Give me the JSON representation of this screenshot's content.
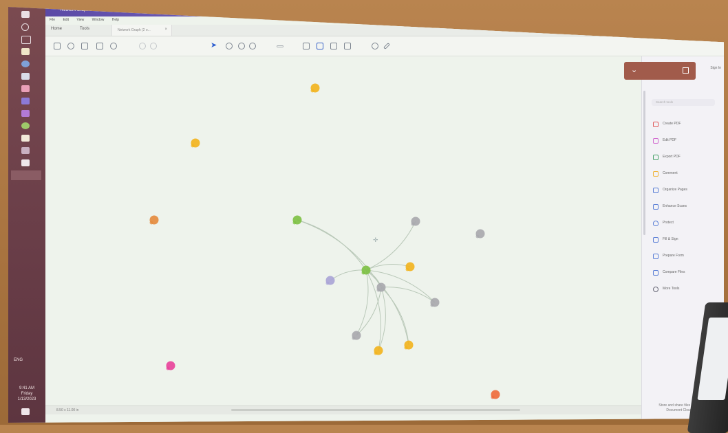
{
  "window": {
    "title": "Network Graph View — Document (2 of 10).pdf - Reader Pro"
  },
  "menu": [
    "File",
    "Edit",
    "View",
    "Window",
    "Help"
  ],
  "app_tabs": [
    "Home",
    "Tools"
  ],
  "document_tab": {
    "label": "Network Graph (2 o...",
    "close": "×"
  },
  "toolbar": {
    "icons": [
      "new-icon",
      "upload-icon",
      "print-icon",
      "mail-icon",
      "search-icon",
      "prev-page-icon",
      "next-page-icon",
      "select-cursor-icon",
      "hand-icon",
      "zoom-out-icon",
      "zoom-in-icon",
      "comment-icon",
      "highlight-icon",
      "draw-icon",
      "stamp-icon",
      "text-icon",
      "pen-icon",
      "sign-icon"
    ]
  },
  "graph": {
    "nodes": [
      {
        "id": "n1",
        "color": "#f2b21c"
      },
      {
        "id": "n2",
        "color": "#f2b21c"
      },
      {
        "id": "n3",
        "color": "#e48a3c"
      },
      {
        "id": "n4",
        "color": "#7cc043"
      },
      {
        "id": "n5",
        "color": "#7cc043"
      },
      {
        "id": "n6",
        "color": "#a7a7ad"
      },
      {
        "id": "n7",
        "color": "#a7a7ad"
      },
      {
        "id": "n8",
        "color": "#f2b21c"
      },
      {
        "id": "n9",
        "color": "#a7a7ad"
      },
      {
        "id": "n10",
        "color": "#a7a7ad"
      },
      {
        "id": "n11",
        "color": "#a8a3d6"
      },
      {
        "id": "n12",
        "color": "#a7a7ad"
      },
      {
        "id": "n13",
        "color": "#f2b21c"
      },
      {
        "id": "n14",
        "color": "#f2b21c"
      },
      {
        "id": "n15",
        "color": "#e8409a"
      },
      {
        "id": "n16",
        "color": "#ee6a3a"
      }
    ],
    "edges": [
      [
        "n4",
        "n5"
      ],
      [
        "n4",
        "n6"
      ],
      [
        "n5",
        "n6"
      ],
      [
        "n5",
        "n8"
      ],
      [
        "n5",
        "n9"
      ],
      [
        "n5",
        "n12"
      ],
      [
        "n5",
        "n13"
      ],
      [
        "n5",
        "n14"
      ],
      [
        "n6",
        "n13"
      ],
      [
        "n6",
        "n14"
      ],
      [
        "n6",
        "n9"
      ],
      [
        "n6",
        "n12"
      ],
      [
        "n11",
        "n5"
      ],
      [
        "n7",
        "n5"
      ]
    ]
  },
  "status": {
    "text": "8.50 x 11.00 in"
  },
  "right_panel": {
    "header_chevron": "⌄",
    "sign_in": "Sign In",
    "search_placeholder": "Search tools",
    "tools": [
      {
        "label": "Create PDF",
        "icon": "create-pdf-icon",
        "color": "#e05a5a"
      },
      {
        "label": "Edit PDF",
        "icon": "edit-pdf-icon",
        "color": "#d26bd0"
      },
      {
        "label": "Export PDF",
        "icon": "export-pdf-icon",
        "color": "#4aa36b"
      },
      {
        "label": "Comment",
        "icon": "comment-icon",
        "color": "#f0b43a"
      },
      {
        "label": "Organize Pages",
        "icon": "organize-pages-icon",
        "color": "#5b7fd6"
      },
      {
        "label": "Enhance Scans",
        "icon": "enhance-scans-icon",
        "color": "#5b7fd6"
      },
      {
        "label": "Protect",
        "icon": "protect-icon",
        "color": "#5b7fd6"
      },
      {
        "label": "Fill & Sign",
        "icon": "fill-sign-icon",
        "color": "#5b7fd6"
      },
      {
        "label": "Prepare Form",
        "icon": "prepare-form-icon",
        "color": "#5b7fd6"
      },
      {
        "label": "Compare Files",
        "icon": "compare-files-icon",
        "color": "#5b7fd6"
      },
      {
        "label": "More Tools",
        "icon": "more-tools-icon",
        "color": "#6a6a78"
      }
    ],
    "footer": "Store and share files in the Document Cloud"
  },
  "taskbar": {
    "clock_line1": "9:41 AM",
    "clock_line2": "Friday",
    "clock_line3": "1/13/2023",
    "tray": "ENG"
  }
}
